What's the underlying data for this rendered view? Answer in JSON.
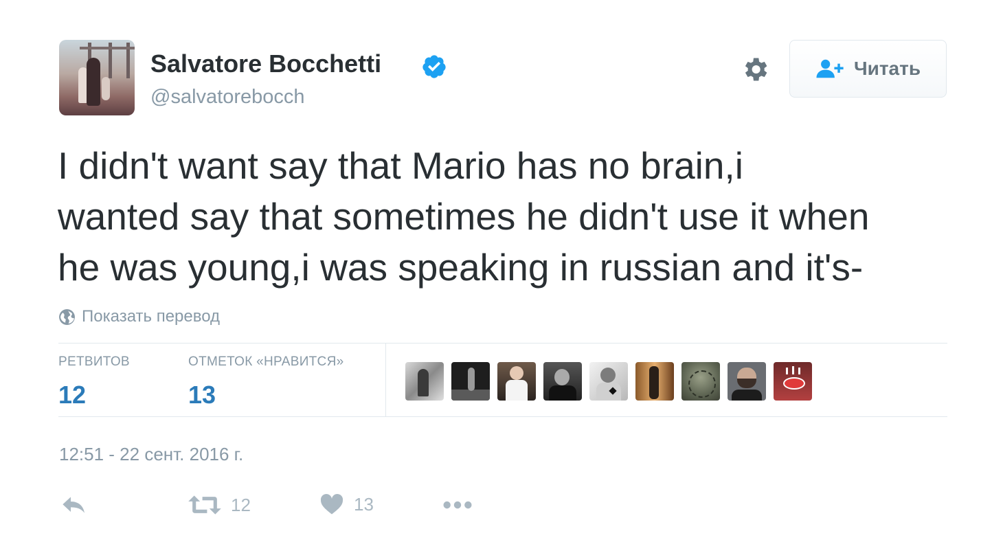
{
  "user": {
    "name": "Salvatore Bocchetti",
    "handle": "@salvatorebocch",
    "verified": true
  },
  "follow_button": {
    "label": "Читать",
    "icon": "add-person-icon"
  },
  "settings_icon": "gear-icon",
  "tweet": {
    "lines": [
      "I didn't want say that Mario has no brain,i",
      "wanted say that sometimes he didn't use it when",
      "he was young,i was speaking in russian and it's-"
    ]
  },
  "translate": {
    "label": "Показать перевод",
    "icon": "globe-icon"
  },
  "stats": {
    "retweets": {
      "label": "РЕТВИТОВ",
      "value": "12"
    },
    "likes": {
      "label": "ОТМЕТОК «НРАВИТСЯ»",
      "value": "13"
    }
  },
  "timestamp": "12:51 - 22 сент. 2016 г.",
  "actions": {
    "reply": {
      "icon": "reply-icon"
    },
    "retweet": {
      "icon": "retweet-icon",
      "count": "12"
    },
    "like": {
      "icon": "heart-icon",
      "count": "13"
    },
    "more": {
      "icon": "more-dots-icon"
    }
  },
  "colors": {
    "text": "#292f33",
    "muted": "#8899a6",
    "link": "#2b7bb9",
    "verified": "#1da1f2",
    "border": "#e1e8ed",
    "action_gray": "#aab8c2"
  }
}
